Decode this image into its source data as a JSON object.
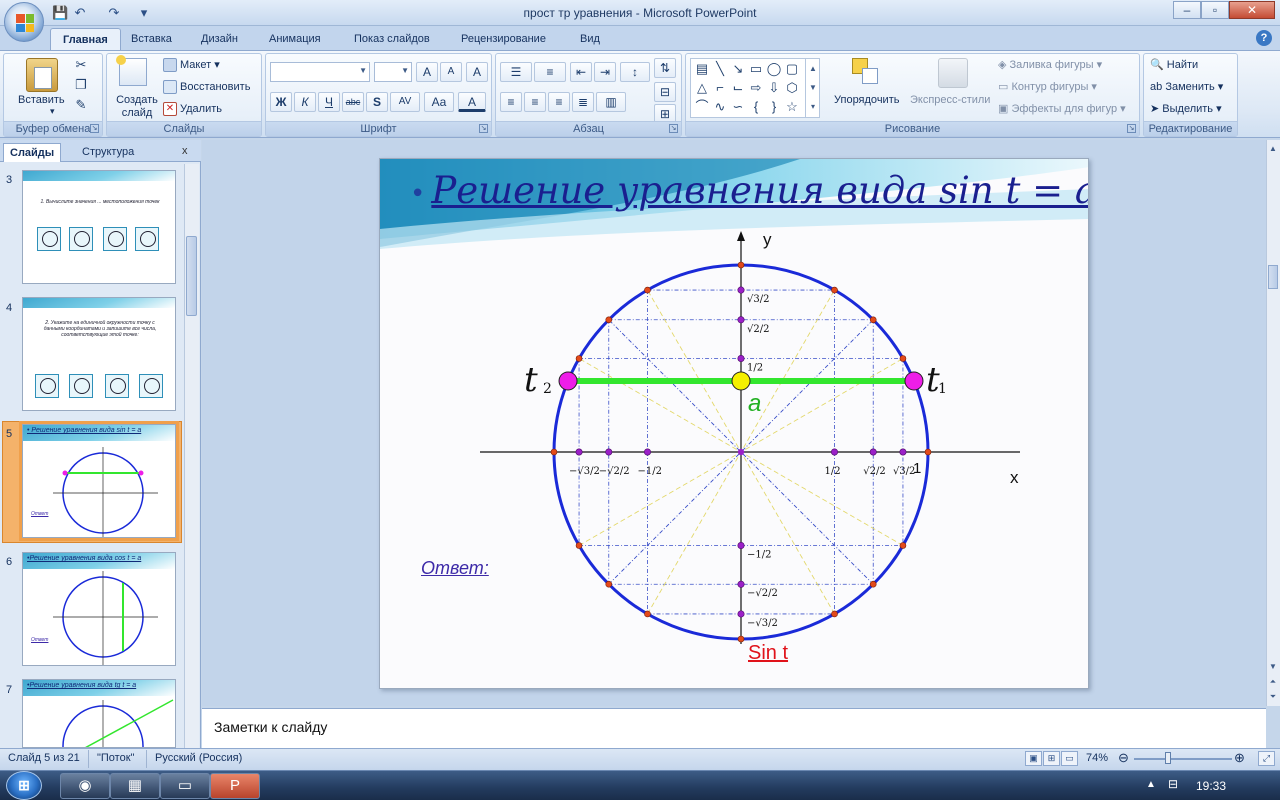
{
  "window": {
    "title": "прост тр уравнения - Microsoft PowerPoint",
    "minimize": "–",
    "maximize": "▫",
    "close": "✕"
  },
  "quick_access": {
    "save": "💾",
    "undo": "↶",
    "redo": "↷",
    "customize": "▾"
  },
  "ribbon": {
    "tabs": [
      "Главная",
      "Вставка",
      "Дизайн",
      "Анимация",
      "Показ слайдов",
      "Рецензирование",
      "Вид"
    ],
    "active_tab": "Главная",
    "groups": {
      "clipboard": {
        "label": "Буфер обмена",
        "paste": "Вставить"
      },
      "slides": {
        "label": "Слайды",
        "new_slide": "Создать слайд",
        "layout": "Макет",
        "reset": "Восстановить",
        "delete": "Удалить"
      },
      "font": {
        "label": "Шрифт",
        "bold": "Ж",
        "italic": "К",
        "underline": "Ч",
        "strike": "abc",
        "shadow": "S",
        "spacing": "AV",
        "case": "Aa",
        "grow": "A",
        "shrink": "A",
        "clear": "A"
      },
      "paragraph": {
        "label": "Абзац"
      },
      "drawing": {
        "label": "Рисование",
        "arrange": "Упорядочить",
        "quick_styles": "Экспресс-стили",
        "shape_fill": "Заливка фигуры",
        "shape_outline": "Контур фигуры",
        "shape_effects": "Эффекты для фигур"
      },
      "editing": {
        "label": "Редактирование",
        "find": "Найти",
        "replace": "Заменить",
        "select": "Выделить"
      }
    }
  },
  "left_pane": {
    "tabs": [
      "Слайды",
      "Структура"
    ],
    "close": "x",
    "thumbnails": [
      {
        "num": "3",
        "text": "1. Вычислите значения ... местоположения точек"
      },
      {
        "num": "4",
        "text": "2. Укажите на единичной окружности точку с данными координатами и запишите все числа, соответствующие этой точке:"
      },
      {
        "num": "5",
        "title": "• Решение уравнения вида sin t = a",
        "answer": "Ответ"
      },
      {
        "num": "6",
        "title": "•Решение уравнения вида cos t = a",
        "answer": "Ответ"
      },
      {
        "num": "7",
        "title": "•Решение уравнения вида tg t = a"
      }
    ]
  },
  "slide": {
    "bullet": "•",
    "title": "Решение уравнения вида sin t = a",
    "answer_label": "Ответ:",
    "axis_label_x": "x",
    "axis_label_y": "y",
    "t1": "t",
    "t1_sub": "1",
    "t2": "t",
    "t2_sub": "2",
    "a_label": "a",
    "one_label": "1",
    "sin_t": "Sin t",
    "y_tick_labels": [
      "√3/2",
      "√2/2",
      "1/2",
      "−1/2",
      "−√2/2",
      "−√3/2"
    ],
    "x_tick_labels": [
      "−√3/2",
      "−√2/2",
      "−1/2",
      "1/2",
      "√2/2",
      "√3/2"
    ],
    "colors": {
      "circle": "#1a2ad8",
      "line_a": "#33e62e",
      "point_t": "#ee1ee8",
      "point_a": "#f5f000",
      "grid_blue": "#3a4fc8",
      "grid_yellow": "#e3d86a",
      "sin_t": "#e0121a"
    }
  },
  "notes": {
    "placeholder": "Заметки к слайду"
  },
  "status": {
    "slide_info": "Слайд 5 из 21",
    "theme": "\"Поток\"",
    "language": "Русский (Россия)",
    "zoom": "74%"
  },
  "taskbar": {
    "start": "⊞",
    "time": "19:33"
  }
}
